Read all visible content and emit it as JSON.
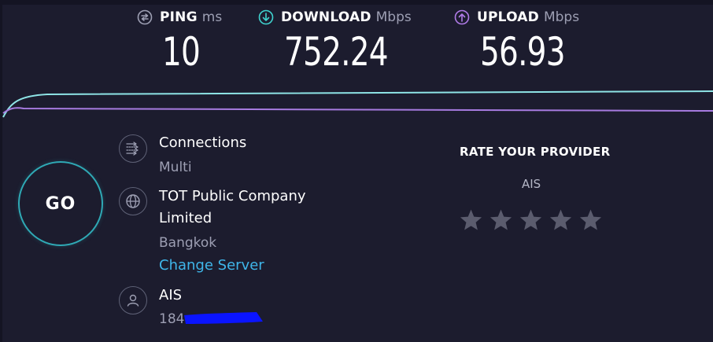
{
  "metrics": {
    "ping": {
      "label": "PING",
      "unit": "ms",
      "value": "10",
      "icon": "ping-icon",
      "color": "#9d9fb3"
    },
    "download": {
      "label": "DOWNLOAD",
      "unit": "Mbps",
      "value": "752.24",
      "icon": "download-icon",
      "color": "#3fd3cf"
    },
    "upload": {
      "label": "UPLOAD",
      "unit": "Mbps",
      "value": "56.93",
      "icon": "upload-icon",
      "color": "#b07be8"
    }
  },
  "go_button": {
    "label": "GO"
  },
  "connections": {
    "title": "Connections",
    "mode": "Multi",
    "icon": "connections-icon"
  },
  "server": {
    "name_line1": "TOT Public Company",
    "name_line2": "Limited",
    "location": "Bangkok",
    "change_label": "Change Server",
    "icon": "globe-icon"
  },
  "isp": {
    "name": "AIS",
    "ip": "184.",
    "icon": "user-icon"
  },
  "rating": {
    "title": "RATE YOUR PROVIDER",
    "provider": "AIS",
    "max_stars": 5,
    "selected": 0
  },
  "colors": {
    "background": "#1c1c2e",
    "download_line": "#8ee4e6",
    "upload_line": "#a77be0",
    "link": "#3fb6ea",
    "go_ring": "#2fa9b5",
    "redaction": "#0a14ff"
  }
}
